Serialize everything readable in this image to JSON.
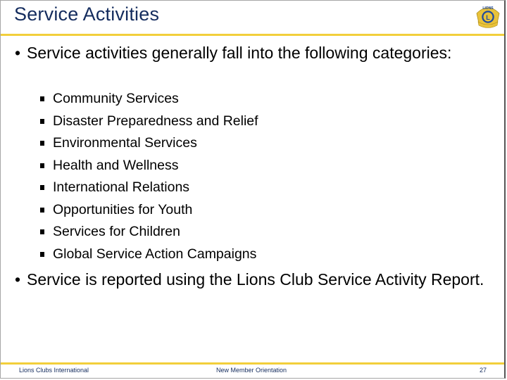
{
  "slide": {
    "title": "Service Activities",
    "accent_color": "#f2cf3b",
    "title_color": "#142c5e",
    "logo": "lions-clubs-emblem-icon",
    "bullets": [
      {
        "text": "Service activities generally fall into the following categories:",
        "sub_items": [
          "Community Services",
          "Disaster Preparedness and Relief",
          "Environmental Services",
          "Health and Wellness",
          "International Relations",
          "Opportunities for Youth",
          "Services for Children",
          "Global Service Action Campaigns"
        ]
      },
      {
        "text": "Service is reported using the Lions Club Service Activity Report."
      }
    ]
  },
  "footer": {
    "left": "Lions Clubs International",
    "center": "New Member Orientation",
    "page_number": "27"
  }
}
